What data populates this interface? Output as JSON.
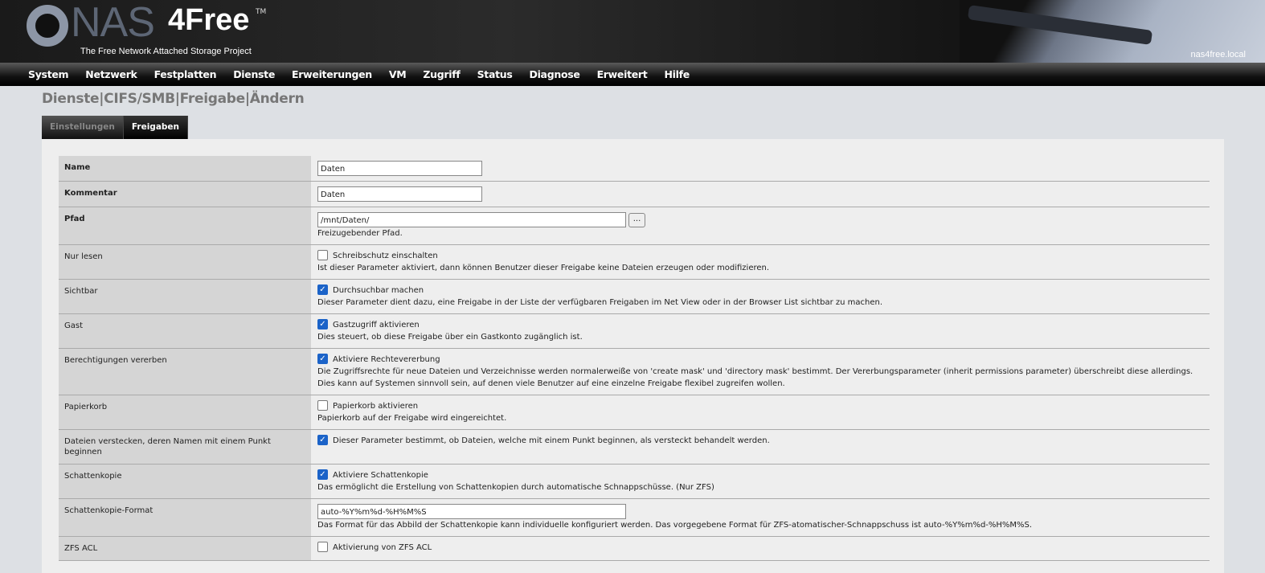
{
  "header": {
    "logo_nas": "NAS",
    "logo_free": "4Free",
    "logo_tm": "TM",
    "tagline": "The Free Network Attached Storage Project",
    "hostname": "nas4free.local"
  },
  "nav": [
    "System",
    "Netzwerk",
    "Festplatten",
    "Dienste",
    "Erweiterungen",
    "VM",
    "Zugriff",
    "Status",
    "Diagnose",
    "Erweitert",
    "Hilfe"
  ],
  "breadcrumb": "Dienste|CIFS/SMB|Freigabe|Ändern",
  "tabs": [
    {
      "label": "Einstellungen",
      "active": false
    },
    {
      "label": "Freigaben",
      "active": true
    }
  ],
  "colors": {
    "checkbox_checked": "#1b63c8",
    "label_bg": "#d5d5d5",
    "page_bg": "#dde0e4"
  },
  "rows": [
    {
      "label": "Name",
      "bold": true,
      "type": "text",
      "value": "Daten",
      "width": 205
    },
    {
      "label": "Kommentar",
      "bold": true,
      "type": "text",
      "value": "Daten",
      "width": 205
    },
    {
      "label": "Pfad",
      "bold": true,
      "type": "path",
      "value": "/mnt/Daten/",
      "button": "...",
      "desc": "Freizugebender Pfad.",
      "width": 384
    },
    {
      "label": "Nur lesen",
      "type": "checkbox",
      "checked": false,
      "option": "Schreibschutz einschalten",
      "desc": "Ist dieser Parameter aktiviert, dann können Benutzer dieser Freigabe keine Dateien erzeugen oder modifizieren."
    },
    {
      "label": "Sichtbar",
      "type": "checkbox",
      "checked": true,
      "option": "Durchsuchbar machen",
      "desc": "Dieser Parameter dient dazu, eine Freigabe in der Liste der verfügbaren Freigaben im Net View oder in der Browser List sichtbar zu machen."
    },
    {
      "label": "Gast",
      "type": "checkbox",
      "checked": true,
      "option": "Gastzugriff aktivieren",
      "desc": "Dies steuert, ob diese Freigabe über ein Gastkonto zugänglich ist."
    },
    {
      "label": "Berechtigungen vererben",
      "type": "checkbox",
      "checked": true,
      "option": "Aktiviere Rechtevererbung",
      "desc": "Die Zugriffsrechte für neue Dateien und Verzeichnisse werden normalerweiße von 'create mask' und 'directory mask' bestimmt. Der Vererbungsparameter (inherit permissions parameter) überschreibt diese allerdings. Dies kann auf Systemen sinnvoll sein, auf denen viele Benutzer auf eine einzelne Freigabe flexibel zugreifen wollen."
    },
    {
      "label": "Papierkorb",
      "type": "checkbox",
      "checked": false,
      "option": "Papierkorb aktivieren",
      "desc": "Papierkorb auf der Freigabe wird eingereichtet."
    },
    {
      "label": "Dateien verstecken, deren Namen mit einem Punkt beginnen",
      "type": "checkbox",
      "checked": true,
      "option": "Dieser Parameter bestimmt, ob Dateien, welche mit einem Punkt beginnen, als versteckt behandelt werden."
    },
    {
      "label": "Schattenkopie",
      "type": "checkbox",
      "checked": true,
      "option": "Aktiviere Schattenkopie",
      "desc": "Das ermöglicht die Erstellung von Schattenkopien durch automatische Schnappschüsse. (Nur ZFS)"
    },
    {
      "label": "Schattenkopie-Format",
      "type": "text",
      "value": "auto-%Y%m%d-%H%M%S",
      "desc": "Das Format für das Abbild der Schattenkopie kann individuelle konfiguriert werden. Das vorgegebene Format für ZFS-atomatischer-Schnappschuss ist auto-%Y%m%d-%H%M%S.",
      "width": 384
    },
    {
      "label": "ZFS ACL",
      "type": "checkbox",
      "checked": false,
      "option": "Aktivierung von ZFS ACL"
    }
  ]
}
